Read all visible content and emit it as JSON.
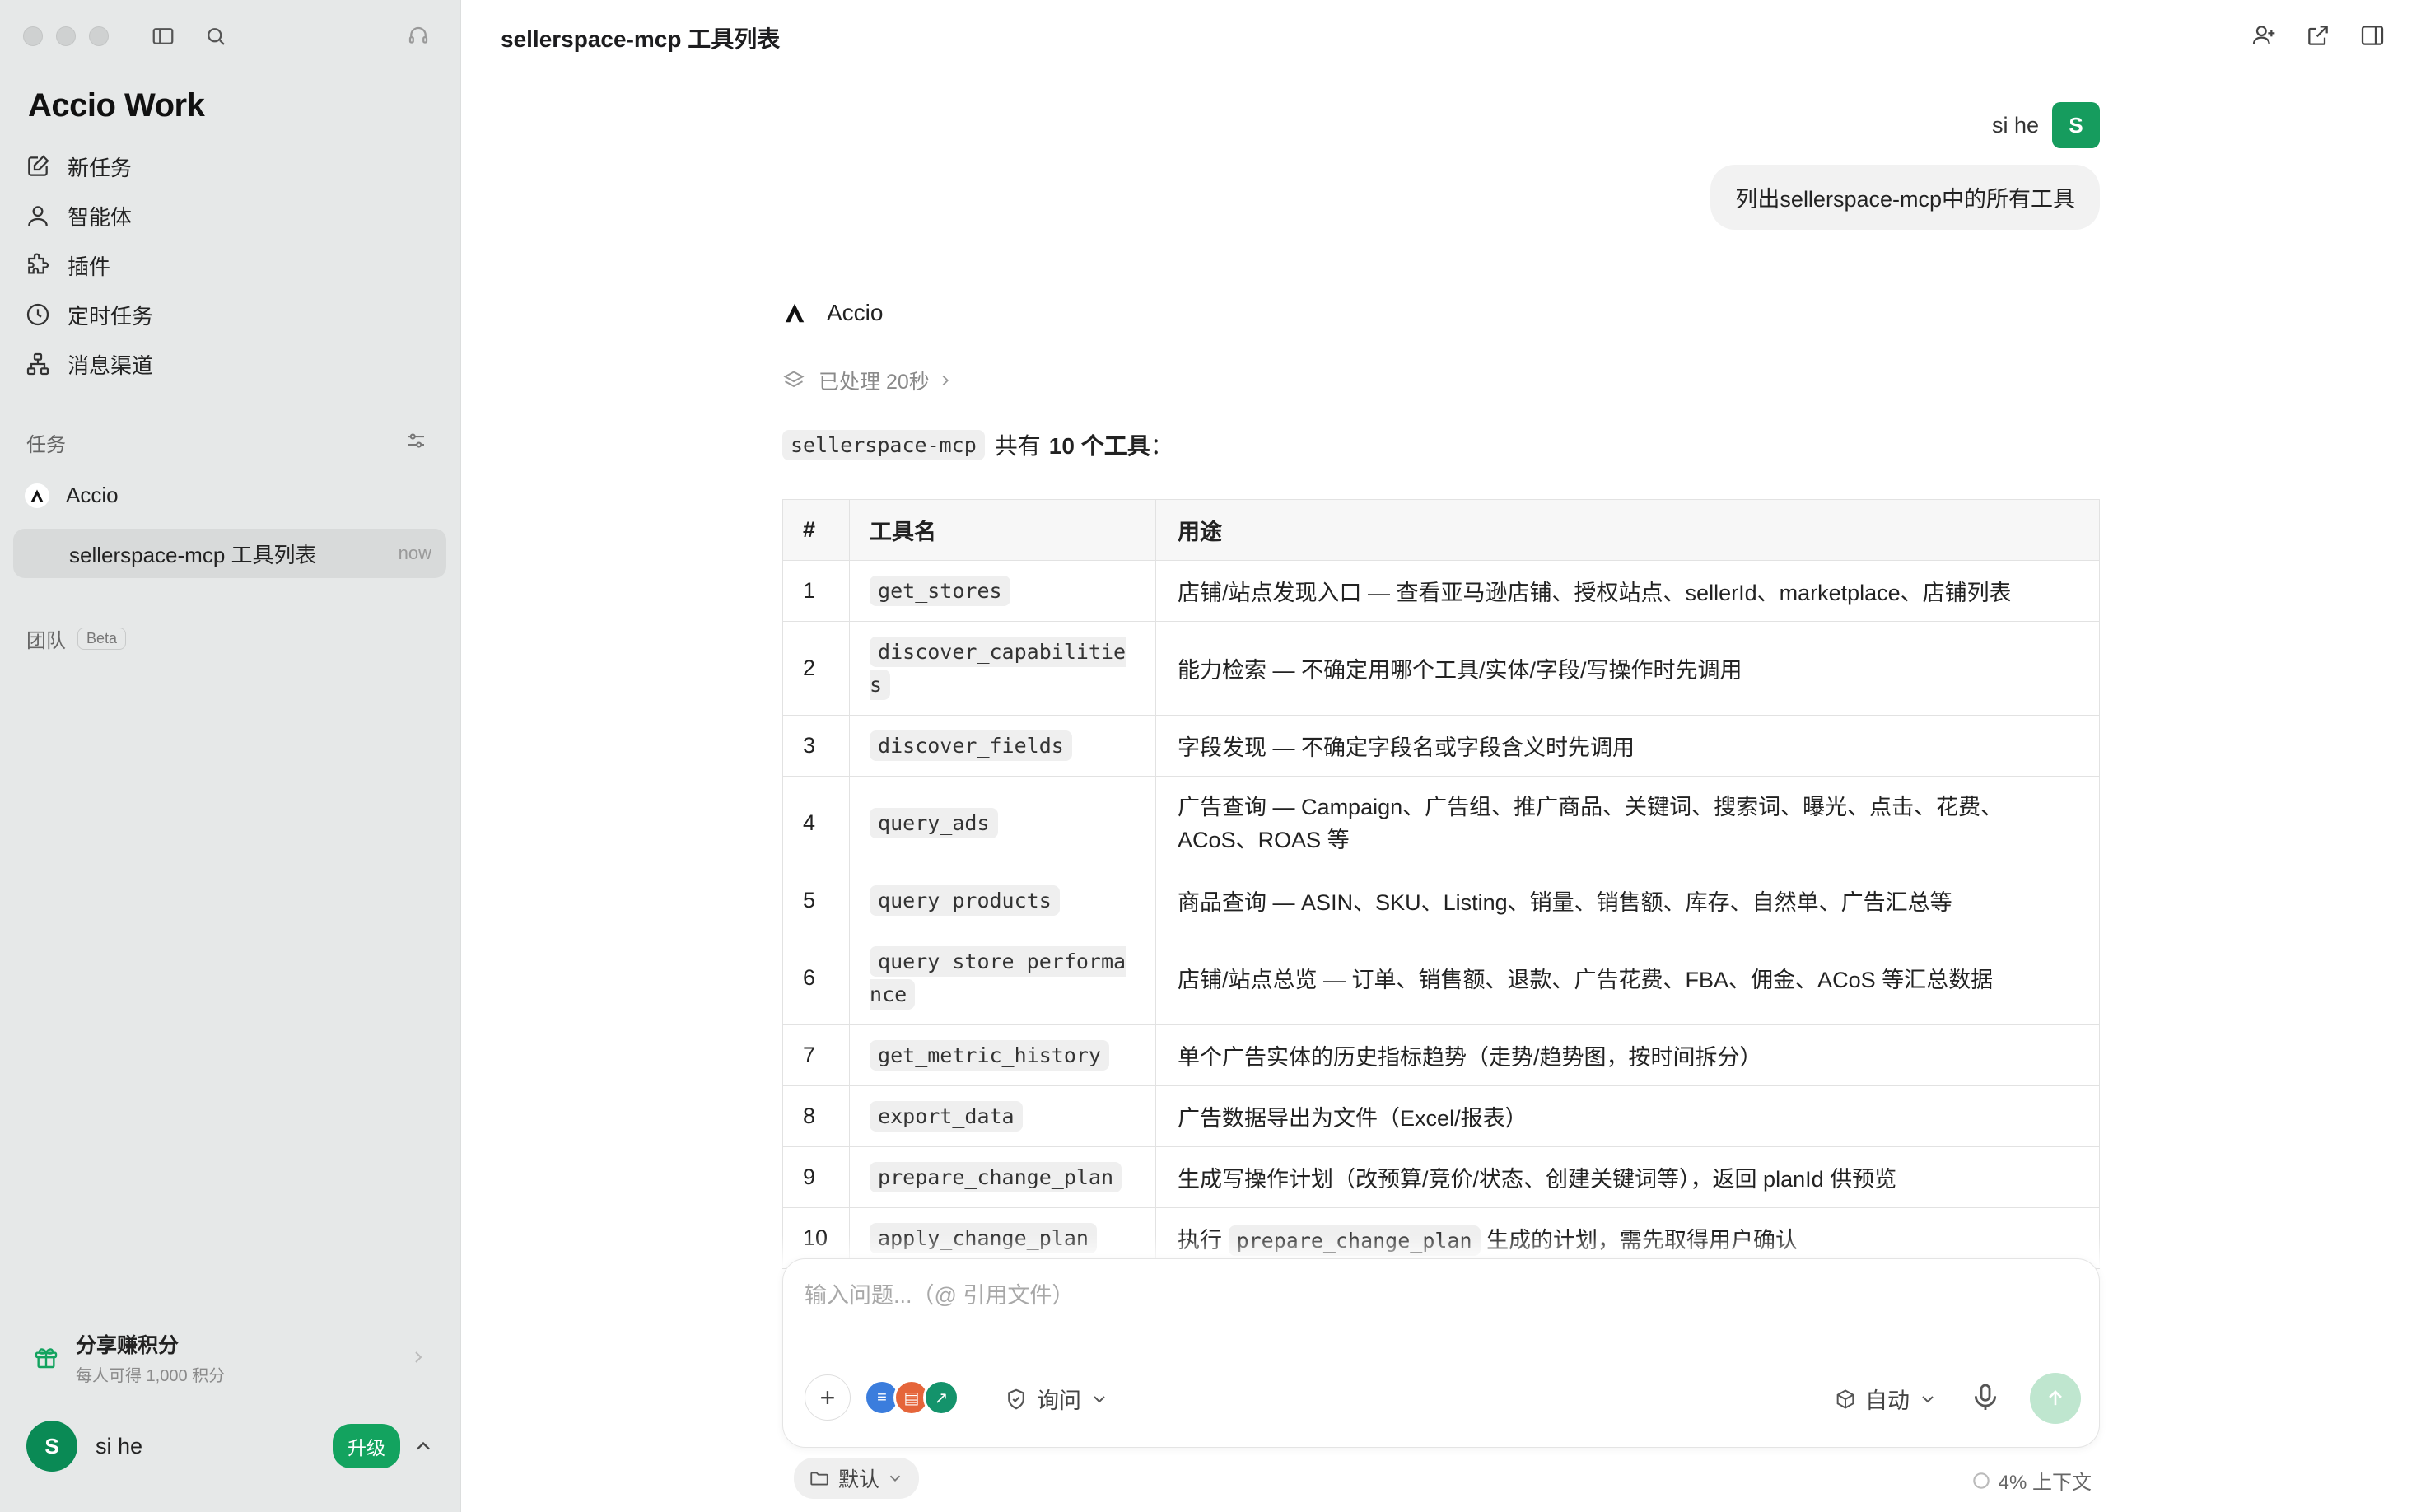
{
  "sidebar": {
    "brand": "Accio Work",
    "nav": [
      {
        "label": "新任务",
        "icon": "edit-icon"
      },
      {
        "label": "智能体",
        "icon": "person-icon"
      },
      {
        "label": "插件",
        "icon": "puzzle-icon"
      },
      {
        "label": "定时任务",
        "icon": "clock-icon"
      },
      {
        "label": "消息渠道",
        "icon": "channel-icon"
      }
    ],
    "tasks_label": "任务",
    "task_group": "Accio",
    "active_task": {
      "title": "sellerspace-mcp 工具列表",
      "time": "now"
    },
    "team_label": "团队",
    "team_badge": "Beta",
    "share_title": "分享赚积分",
    "share_subtitle": "每人可得 1,000 积分",
    "user": {
      "initial": "S",
      "name": "si he",
      "upgrade": "升级"
    }
  },
  "header": {
    "title": "sellerspace-mcp 工具列表"
  },
  "conversation": {
    "user_name": "si he",
    "user_initial": "S",
    "user_message": "列出sellerspace-mcp中的所有工具",
    "assistant_name": "Accio",
    "processed": "已处理 20秒",
    "intro_code": "sellerspace-mcp",
    "intro_prefix": "共有",
    "intro_bold": "10 个工具",
    "intro_suffix": "："
  },
  "table": {
    "headers": [
      "#",
      "工具名",
      "用途"
    ],
    "rows": [
      {
        "n": "1",
        "tool": "get_stores",
        "desc": "店铺/站点发现入口 — 查看亚马逊店铺、授权站点、sellerId、marketplace、店铺列表"
      },
      {
        "n": "2",
        "tool": "discover_capabilities",
        "desc": "能力检索 — 不确定用哪个工具/实体/字段/写操作时先调用"
      },
      {
        "n": "3",
        "tool": "discover_fields",
        "desc": "字段发现 — 不确定字段名或字段含义时先调用"
      },
      {
        "n": "4",
        "tool": "query_ads",
        "desc": "广告查询 — Campaign、广告组、推广商品、关键词、搜索词、曝光、点击、花费、ACoS、ROAS 等"
      },
      {
        "n": "5",
        "tool": "query_products",
        "desc": "商品查询 — ASIN、SKU、Listing、销量、销售额、库存、自然单、广告汇总等"
      },
      {
        "n": "6",
        "tool": "query_store_performance",
        "desc": "店铺/站点总览 — 订单、销售额、退款、广告花费、FBA、佣金、ACoS 等汇总数据"
      },
      {
        "n": "7",
        "tool": "get_metric_history",
        "desc": "单个广告实体的历史指标趋势（走势/趋势图，按时间拆分）"
      },
      {
        "n": "8",
        "tool": "export_data",
        "desc": "广告数据导出为文件（Excel/报表）"
      },
      {
        "n": "9",
        "tool": "prepare_change_plan",
        "desc": "生成写操作计划（改预算/竞价/状态、创建关键词等），返回 planId 供预览"
      },
      {
        "n": "10",
        "tool": "apply_change_plan",
        "desc_prefix": "执行",
        "desc_code": "prepare_change_plan",
        "desc_suffix": "生成的计划，需先取得用户确认"
      }
    ]
  },
  "composer": {
    "placeholder": "输入问题...（@ 引用文件）",
    "ask_mode": "询问",
    "model": "自动",
    "workspace": "默认",
    "context": "4% 上下文"
  },
  "colors": {
    "accent": "#13a35f",
    "sidebar_bg": "#e6e8e8",
    "send_disabled": "#bfe6cf"
  }
}
